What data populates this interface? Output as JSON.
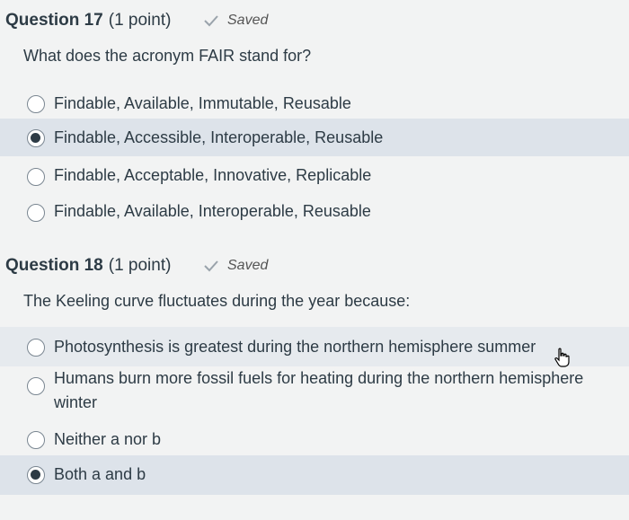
{
  "q17": {
    "title": "Question 17",
    "points": "(1 point)",
    "status": "Saved",
    "prompt": "What does the acronym FAIR stand for?",
    "answers": [
      {
        "label": "Findable, Available, Immutable, Reusable",
        "selected": false
      },
      {
        "label": "Findable, Accessible, Interoperable, Reusable",
        "selected": true
      },
      {
        "label": "Findable, Acceptable, Innovative, Replicable",
        "selected": false
      },
      {
        "label": "Findable, Available, Interoperable, Reusable",
        "selected": false
      }
    ]
  },
  "q18": {
    "title": "Question 18",
    "points": "(1 point)",
    "status": "Saved",
    "prompt": "The Keeling curve fluctuates during the year because:",
    "answers": [
      {
        "label": "Photosynthesis is greatest during the northern hemisphere summer",
        "selected": false
      },
      {
        "label": "Humans burn more fossil fuels for heating during the northern hemisphere winter",
        "selected": false
      },
      {
        "label": "Neither a nor b",
        "selected": false
      },
      {
        "label": "Both a and b",
        "selected": true
      }
    ]
  },
  "icons": {
    "saved_check": "checkmark-icon",
    "cursor": "hand-pointer-icon"
  },
  "colors": {
    "selected_row": "#dde3ea",
    "text": "#2d3b45",
    "check": "#9aa3ab"
  }
}
